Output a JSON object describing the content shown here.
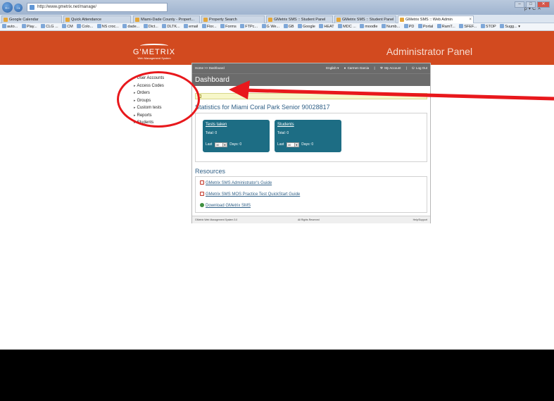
{
  "browser": {
    "address": "http://www.gmetrix.net/manage/",
    "back_icon": "back-arrow-icon",
    "forward_icon": "forward-arrow-icon",
    "search_tools": "ρ ▾ C ✕",
    "window_min": "–",
    "window_max": "□",
    "window_close": "✕",
    "tabs": [
      {
        "label": "Google Calendar"
      },
      {
        "label": "Quick Attendance"
      },
      {
        "label": "Miami-Dade County - Propert..."
      },
      {
        "label": "Property Search"
      },
      {
        "label": "GMetrix SMS :: Student Panel"
      },
      {
        "label": "GMetrix SMS :: Student Panel"
      },
      {
        "label": "GMetrix SMS :: Web Admin"
      }
    ],
    "tab_close": "×",
    "bookmarks": [
      "auto...",
      "Play...",
      "CLG ...",
      "CM",
      "Colo...",
      "NS croc...",
      "dade...",
      "Dict...",
      "DLTK...",
      "email",
      "Flor...",
      "Forms",
      "FTPc...",
      "G We...",
      "GB",
      "Google",
      "HEAT",
      "MDC ...",
      "moodle",
      "Numb...",
      "PD",
      "Portal",
      "RamT...",
      "SFEF...",
      "STOP",
      "Sugg... ▾"
    ]
  },
  "header": {
    "logo_name": "G'METRIX",
    "logo_sub": "Web Management System",
    "title": "Administrator Panel"
  },
  "sidebar": {
    "items": [
      {
        "label": "User Accounts"
      },
      {
        "label": "Access Codes"
      },
      {
        "label": "Orders"
      },
      {
        "label": "Groups"
      },
      {
        "label": "Custom tests"
      },
      {
        "label": "Reports"
      },
      {
        "label": "Students"
      }
    ]
  },
  "panel": {
    "breadcrumb": "Home >> Dashboard",
    "language": "English ▾",
    "user": "Carmen Garcia",
    "my_account": "My Account",
    "log_out": "Log Out",
    "separator": "|",
    "title": "Dashboard",
    "statistics_title": "Statistics for Miami Coral Park Senior 90028817",
    "cards": [
      {
        "title": "Tests taken",
        "total": "Total: 0",
        "last_label": "Last",
        "last_value": "30",
        "days": "Days: 0"
      },
      {
        "title": "Students",
        "total": "Total: 0",
        "last_label": "Last",
        "last_value": "30",
        "days": "Days: 0"
      }
    ],
    "resources_title": "Resources",
    "resources": [
      {
        "label": "GMetrix SMS Administrator's Guide",
        "icon": "pdf-icon"
      },
      {
        "label": "GMetrix SMS MOS Practice Test QuickStart Guide",
        "icon": "pdf-icon"
      },
      {
        "label": "Download GMetrix SMS",
        "icon": "download-icon"
      }
    ],
    "footer_left": "GMetrix Web Management System 3.0",
    "footer_center": "All Rights Reserved",
    "footer_right": "Help/Support"
  },
  "colors": {
    "header": "#d24a1f",
    "card": "#1d6d84",
    "link": "#2f5f86",
    "annotation": "#e8181c"
  }
}
